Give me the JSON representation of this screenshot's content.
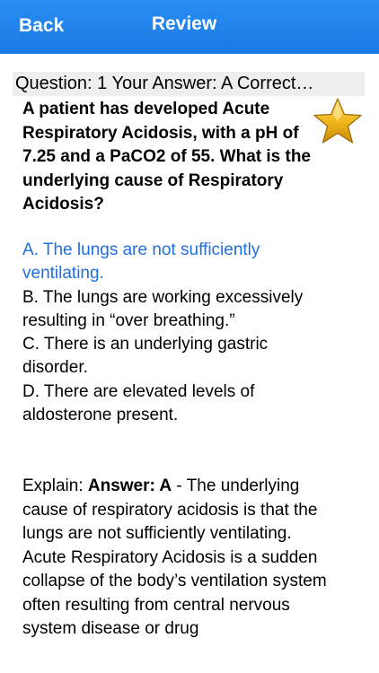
{
  "nav": {
    "back_label": "Back",
    "title": "Review"
  },
  "question": {
    "header": "Question: 1 Your Answer: A Correct…",
    "text": "A patient has developed Acute Respiratory Acidosis, with a pH of 7.25 and a PaCO2 of 55. What is the underlying cause of Respiratory Acidosis?",
    "star_icon": "gold-star-icon"
  },
  "options": [
    {
      "text": "A. The lungs are not sufficiently ventilating.",
      "correct": true
    },
    {
      "text": "B. The lungs are working excessively resulting in “over breathing.”",
      "correct": false
    },
    {
      "text": "C. There is an underlying gastric disorder.",
      "correct": false
    },
    {
      "text": "D. There are elevated levels of aldosterone present.",
      "correct": false
    }
  ],
  "explain": {
    "prefix": "Explain: ",
    "answer_label": "Answer: A",
    "body": " - The underlying cause of respiratory acidosis is that the lungs are not sufficiently ventilating. Acute Respiratory Acidosis is a sudden collapse of the body’s ventilation system often resulting from central nervous system disease or drug"
  },
  "colors": {
    "nav_bg": "#1a79e3",
    "correct_text": "#1f6fe0",
    "header_bg": "#eeeeee"
  }
}
